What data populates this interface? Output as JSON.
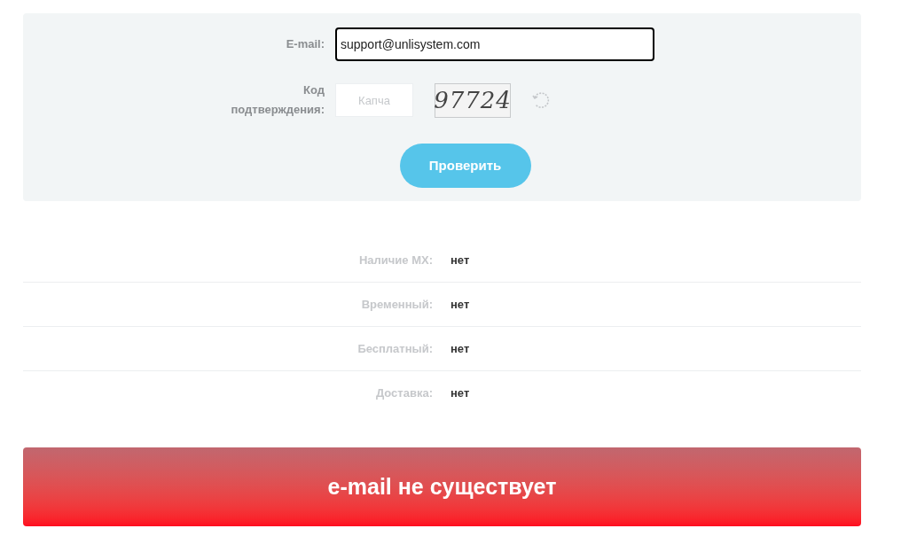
{
  "form": {
    "email": {
      "label": "E-mail:",
      "value": "support@unlisystem.com",
      "focused": true
    },
    "captcha": {
      "label": "Код подтверждения:",
      "placeholder": "Капча",
      "code": "97724"
    },
    "submit": "Проверить"
  },
  "results": [
    {
      "label": "Наличие MX:",
      "value": "нет"
    },
    {
      "label": "Временный:",
      "value": "нет"
    },
    {
      "label": "Бесплатный:",
      "value": "нет"
    },
    {
      "label": "Доставка:",
      "value": "нет"
    }
  ],
  "verdict": {
    "text": "e-mail не существует",
    "kind": "error"
  }
}
